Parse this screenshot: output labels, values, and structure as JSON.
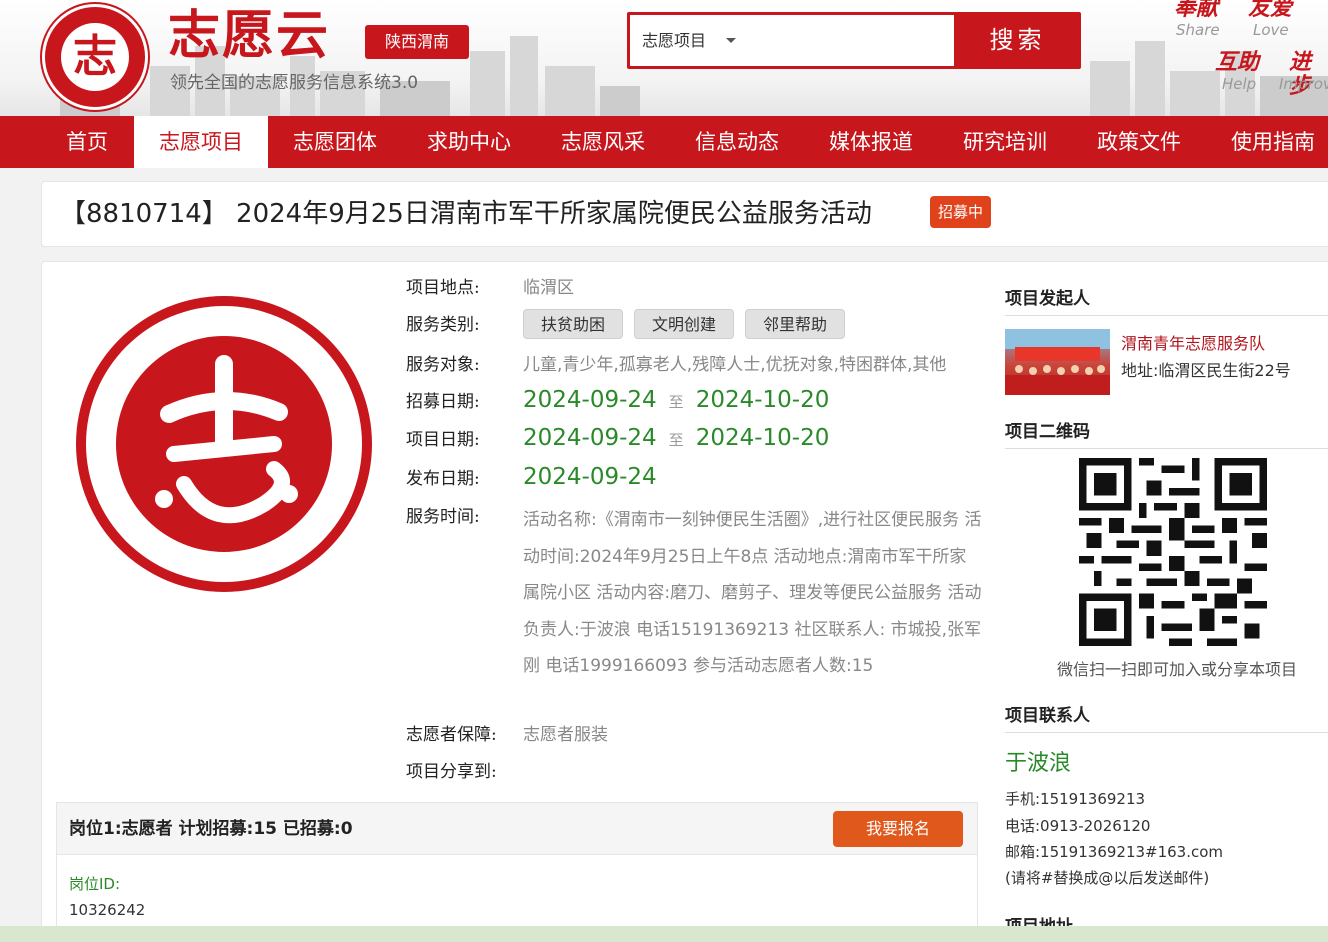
{
  "header": {
    "brand": "志愿云",
    "subtitle": "领先全国的志愿服务信息系统3.0",
    "region": "陕西渭南",
    "logo_char": "志",
    "search": {
      "category": "志愿项目",
      "button": "搜索"
    },
    "slogans": [
      {
        "cn": "奉献",
        "en": "Share"
      },
      {
        "cn": "友爱",
        "en": "Love"
      },
      {
        "cn": "互助",
        "en": "Help"
      },
      {
        "cn": "进步",
        "en": "Improve"
      }
    ]
  },
  "nav": [
    "首页",
    "志愿项目",
    "志愿团体",
    "求助中心",
    "志愿风采",
    "信息动态",
    "媒体报道",
    "研究培训",
    "政策文件",
    "使用指南"
  ],
  "nav_active": "志愿项目",
  "project": {
    "title": "【8810714】 2024年9月25日渭南市军干所家属院便民公益服务活动",
    "status": "招募中",
    "fields": {
      "location_label": "项目地点:",
      "location": "临渭区",
      "category_label": "服务类别:",
      "categories": [
        "扶贫助困",
        "文明创建",
        "邻里帮助"
      ],
      "target_label": "服务对象:",
      "target": "儿童,青少年,孤寡老人,残障人士,优抚对象,特困群体,其他",
      "recruit_label": "招募日期:",
      "recruit_start": "2024-09-24",
      "recruit_end": "2024-10-20",
      "project_label": "项目日期:",
      "project_start": "2024-09-24",
      "project_end": "2024-10-20",
      "date_sep": "至",
      "publish_label": "发布日期:",
      "publish_date": "2024-09-24",
      "time_label": "服务时间:",
      "description": "活动名称:《渭南市一刻钟便民生活圈》,进行社区便民服务 活动时间:2024年9月25日上午8点 活动地点:渭南市军干所家属院小区 活动内容:磨刀、磨剪子、理发等便民公益服务 活动负责人:于波浪 电话15191369213 社区联系人: 市城投,张军刚 电话1999166093 参与活动志愿者人数:15",
      "guarantee_label": "志愿者保障:",
      "guarantee": "志愿者服装",
      "share_label": "项目分享到:"
    },
    "post": {
      "header": "岗位1:志愿者   计划招募:15   已招募:0",
      "signup": "我要报名",
      "id_label": "岗位ID:",
      "id": "10326242"
    }
  },
  "sidebar": {
    "initiator_title": "项目发起人",
    "org_name": "渭南青年志愿服务队",
    "org_address": "地址:临渭区民生街22号",
    "qr_title": "项目二维码",
    "qr_caption": "微信扫一扫即可加入或分享本项目",
    "contact_title": "项目联系人",
    "contact_name": "于波浪",
    "phone": "手机:15191369213",
    "tel": "电话:0913-2026120",
    "email": "邮箱:15191369213#163.com",
    "email_note": "(请将#替换成@以后发送邮件)",
    "address_title": "项目地址"
  },
  "colors": {
    "brand_red": "#c8161d",
    "accent_orange": "#e0581b",
    "date_green": "#2a8a2a"
  }
}
